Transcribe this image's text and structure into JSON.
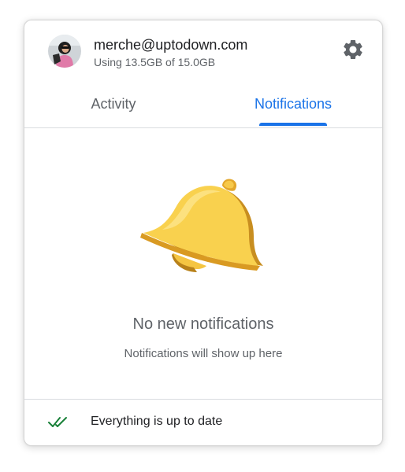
{
  "account": {
    "email": "merche@uptodown.com",
    "usage": "Using 13.5GB of 15.0GB"
  },
  "icons": {
    "settings": "gear-icon",
    "empty_state": "bell-icon",
    "status": "double-check-icon"
  },
  "tabs": [
    {
      "label": "Activity",
      "selected": false
    },
    {
      "label": "Notifications",
      "selected": true
    }
  ],
  "empty_state": {
    "title": "No new notifications",
    "subtitle": "Notifications will show up here"
  },
  "footer": {
    "status": "Everything is up to date"
  },
  "colors": {
    "accent": "#1a73e8",
    "check": "#188038",
    "bell": "#f6c741"
  }
}
